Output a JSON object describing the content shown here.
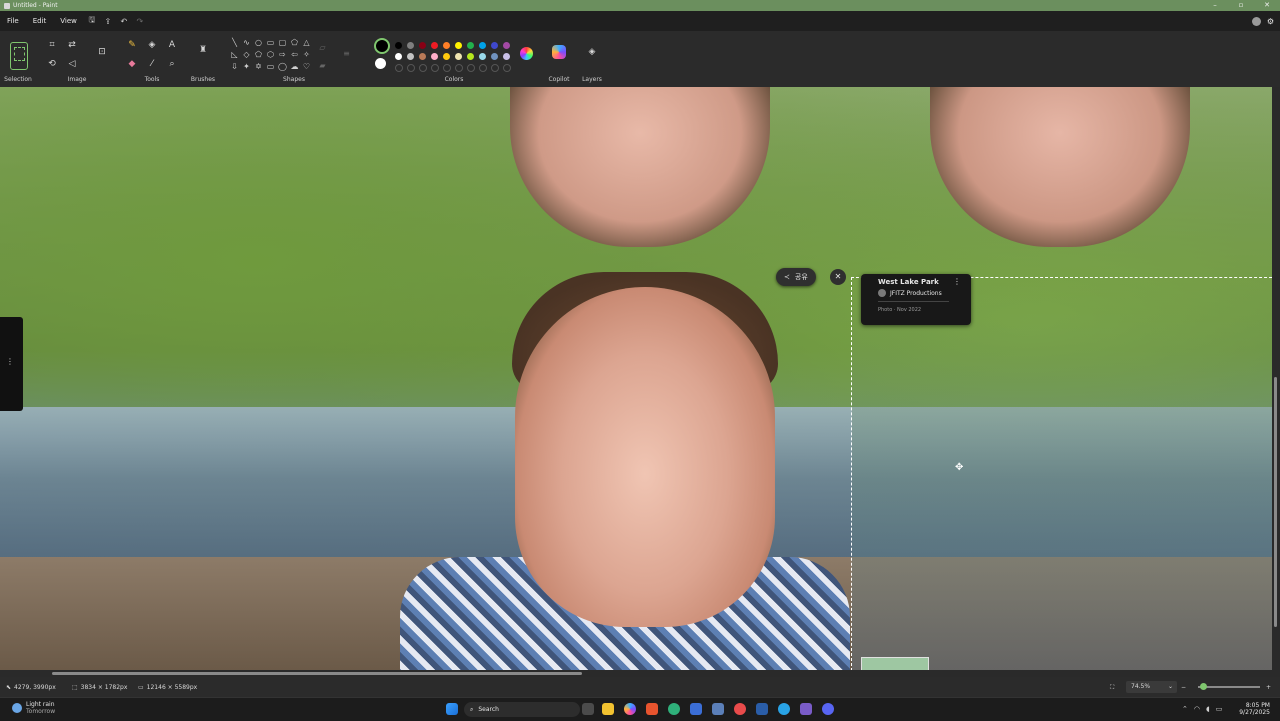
{
  "window": {
    "title": "Untitled - Paint"
  },
  "menu": {
    "file": "File",
    "edit": "Edit",
    "view": "View"
  },
  "ribbon": {
    "groups": {
      "selection": "Selection",
      "image": "Image",
      "tools": "Tools",
      "brushes": "Brushes",
      "shapes": "Shapes",
      "colors": "Colors",
      "copilot": "Copilot",
      "layers": "Layers"
    },
    "palette": [
      "#000000",
      "#7f7f7f",
      "#880015",
      "#ed1c24",
      "#ff7f27",
      "#fff200",
      "#22b14c",
      "#00a2e8",
      "#3f48cc",
      "#a349a4",
      "#ffffff",
      "#c3c3c3",
      "#b97a57",
      "#ffaec9",
      "#ffc90e",
      "#efe4b0",
      "#b5e61d",
      "#99d9ea",
      "#7092be",
      "#c8bfe7"
    ],
    "accent": "#7fc66e"
  },
  "overlay": {
    "share_label": "공유",
    "card": {
      "title": "West Lake Park",
      "owner": "JFITZ Productions",
      "date": "Photo · Nov 2022"
    }
  },
  "status": {
    "cursor_pos": "4279, 3990px",
    "selection_size": "3834 × 1782px",
    "canvas_size": "12146 × 5589px",
    "zoom": "74.5%"
  },
  "taskbar": {
    "weather_main": "Light rain",
    "weather_sub": "Tomorrow",
    "search_label": "Search",
    "time": "8:05 PM",
    "date": "9/27/2025"
  }
}
